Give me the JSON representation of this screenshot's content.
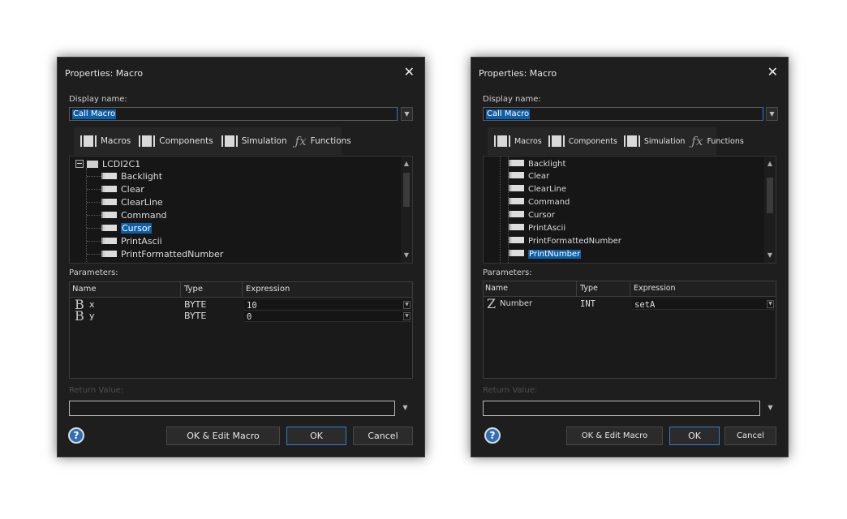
{
  "dialogs": [
    {
      "title": "Properties: Macro",
      "close_glyph": "✕",
      "display_name_label": "Display name:",
      "display_name_value": "Call Macro",
      "tabs": [
        {
          "label": "Macros",
          "icon": "macro-icon"
        },
        {
          "label": "Components",
          "icon": "component-icon"
        },
        {
          "label": "Simulation",
          "icon": "simulation-icon"
        },
        {
          "label": "Functions",
          "icon": "fx-icon"
        }
      ],
      "tree": {
        "root": "LCDI2C1",
        "items": [
          "Backlight",
          "Clear",
          "ClearLine",
          "Command",
          "Cursor",
          "PrintAscii",
          "PrintFormattedNumber"
        ],
        "selected": "Cursor"
      },
      "parameters_label": "Parameters:",
      "columns": [
        "Name",
        "Type",
        "Expression"
      ],
      "params": [
        {
          "glyph": "B",
          "name": "x",
          "type": "BYTE",
          "expression": "10"
        },
        {
          "glyph": "B",
          "name": "y",
          "type": "BYTE",
          "expression": "0"
        }
      ],
      "return_label": "Return Value:",
      "return_value": "",
      "buttons": {
        "help": "?",
        "ok_edit": "OK & Edit Macro",
        "ok": "OK",
        "cancel": "Cancel"
      }
    },
    {
      "title": "Properties: Macro",
      "close_glyph": "✕",
      "display_name_label": "Display name:",
      "display_name_value": "Call Macro",
      "tabs": [
        {
          "label": "Macros",
          "icon": "macro-icon"
        },
        {
          "label": "Components",
          "icon": "component-icon"
        },
        {
          "label": "Simulation",
          "icon": "simulation-icon"
        },
        {
          "label": "Functions",
          "icon": "fx-icon"
        }
      ],
      "tree": {
        "items": [
          "Backlight",
          "Clear",
          "ClearLine",
          "Command",
          "Cursor",
          "PrintAscii",
          "PrintFormattedNumber",
          "PrintNumber"
        ],
        "selected": "PrintNumber"
      },
      "parameters_label": "Parameters:",
      "columns": [
        "Name",
        "Type",
        "Expression"
      ],
      "params": [
        {
          "glyph": "Z",
          "name": "Number",
          "type": "INT",
          "expression": "setA"
        }
      ],
      "return_label": "Return Value:",
      "return_value": "",
      "buttons": {
        "help": "?",
        "ok_edit": "OK & Edit Macro",
        "ok": "OK",
        "cancel": "Cancel"
      }
    }
  ],
  "colors": {
    "dialog_bg": "#1e1e1e",
    "selection": "#0f5fa8",
    "accent_border": "#2f7ec9"
  }
}
